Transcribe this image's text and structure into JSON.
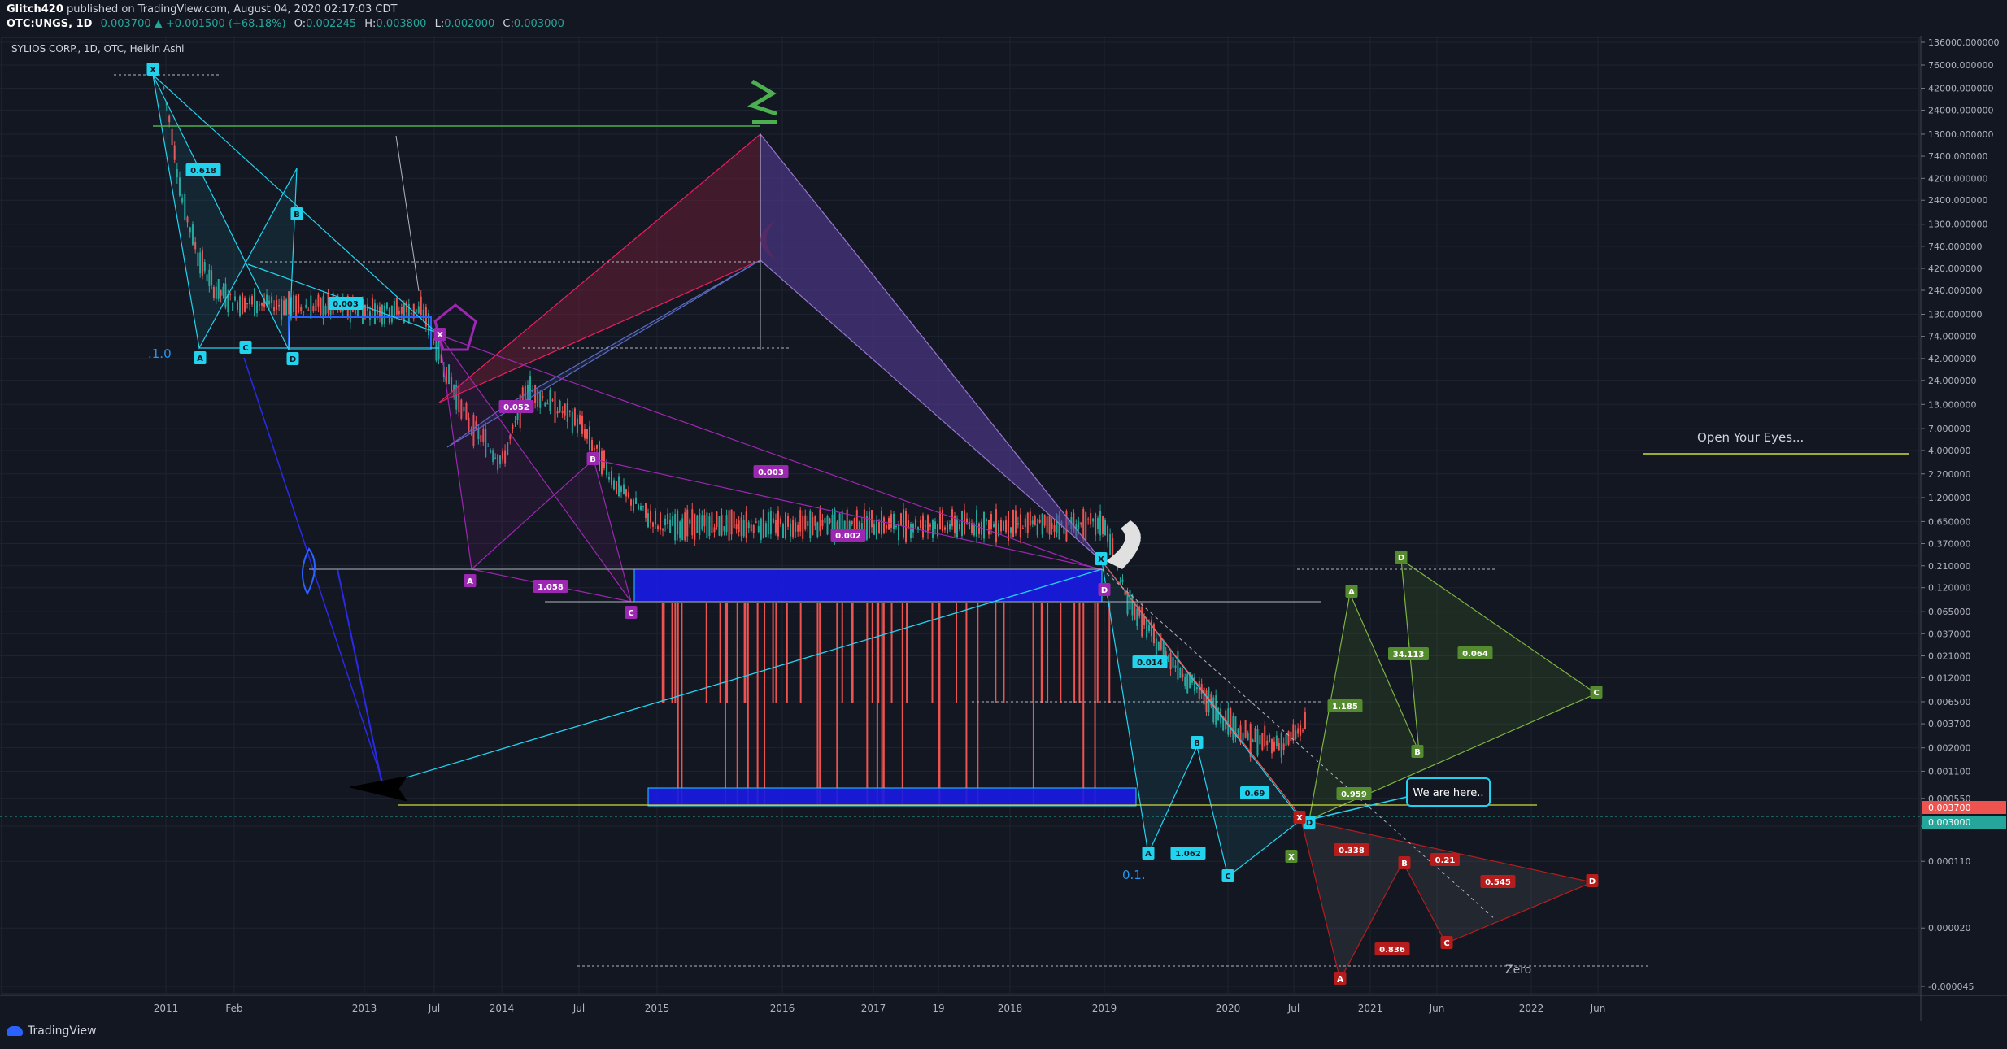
{
  "header": {
    "publisher": "Glitch420",
    "publish_note": "published on TradingView.com, August 04, 2020 02:17:03 CDT",
    "symbol": "OTC:UNGS, 1D",
    "last": "0.003700",
    "change": "+0.001500 (+68.18%)",
    "o_label": "O:",
    "o": "0.002245",
    "h_label": "H:",
    "h": "0.003800",
    "l_label": "L:",
    "l": "0.002000",
    "c_label": "C:",
    "c": "0.003000"
  },
  "legend_title": "SYLIOS CORP., 1D, OTC, Heikin Ashi",
  "brand": "TradingView",
  "colors": {
    "bg": "#131722",
    "grid": "#1e2330",
    "cyan": "#22d3ee",
    "purple": "#9c27b0",
    "blue": "#1a1ae6",
    "green": "#4caf50",
    "red": "#b71c1c",
    "yellow": "#cddc39",
    "candle_up": "#26a69a",
    "candle_down": "#ef5350"
  },
  "chart_data": {
    "type": "candlestick",
    "scale": "log",
    "y_ticks": [
      "136000.000000",
      "76000.000000",
      "42000.000000",
      "24000.000000",
      "13000.000000",
      "7400.000000",
      "4200.000000",
      "2400.000000",
      "1300.000000",
      "740.000000",
      "420.000000",
      "240.000000",
      "130.000000",
      "74.000000",
      "42.000000",
      "24.000000",
      "13.000000",
      "7.000000",
      "4.000000",
      "2.200000",
      "1.200000",
      "0.650000",
      "0.370000",
      "0.210000",
      "0.120000",
      "0.065000",
      "0.037000",
      "0.021000",
      "0.012000",
      "0.006500",
      "0.003700",
      "0.002000",
      "0.001100",
      "0.000550",
      "0.000270",
      "0.000110",
      "0.000020",
      "-0.000045"
    ],
    "y_tick_values": [
      136000,
      76000,
      42000,
      24000,
      13000,
      7400,
      4200,
      2400,
      1300,
      740,
      420,
      240,
      130,
      74,
      42,
      24,
      13,
      7,
      4,
      2.2,
      1.2,
      0.65,
      0.37,
      0.21,
      0.12,
      0.065,
      0.037,
      0.021,
      0.012,
      0.0065,
      0.0037,
      0.002,
      0.0011,
      0.00055,
      0.00027,
      0.00011,
      2e-05,
      4.5e-06
    ],
    "x_ticks": [
      "2011",
      "Feb",
      "2013",
      "Jul",
      "2014",
      "Jul",
      "2015",
      "2016",
      "2017",
      "19",
      "2018",
      "2019",
      "2020",
      "Jul",
      "2021",
      "Jun",
      "2022",
      "Jun"
    ],
    "x_tick_dates": [
      "2011-01-01",
      "2012-02-01",
      "2013-01-01",
      "2013-07-01",
      "2014-01-01",
      "2014-07-01",
      "2015-01-01",
      "2016-01-01",
      "2017-01-01",
      "2017-07-01",
      "2018-01-01",
      "2019-01-01",
      "2020-01-01",
      "2020-07-01",
      "2021-01-01",
      "2021-06-01",
      "2022-01-01",
      "2022-06-01"
    ],
    "price_labels": [
      {
        "text": "0.003700",
        "color": "#ef5350"
      },
      {
        "text": "0.003000",
        "color": "#26a69a"
      }
    ],
    "price_label_values": [
      0.0037,
      0.003
    ],
    "approx_closes": [
      [
        "2010-12-15",
        42000
      ],
      [
        "2011-02-01",
        13000
      ],
      [
        "2011-04-01",
        2400
      ],
      [
        "2011-07-01",
        600
      ],
      [
        "2011-10-01",
        250
      ],
      [
        "2012-02-01",
        180
      ],
      [
        "2012-07-01",
        160
      ],
      [
        "2013-01-01",
        150
      ],
      [
        "2013-06-01",
        140
      ],
      [
        "2013-08-01",
        30
      ],
      [
        "2013-10-01",
        8
      ],
      [
        "2014-01-01",
        3
      ],
      [
        "2014-03-01",
        20
      ],
      [
        "2014-07-01",
        8
      ],
      [
        "2014-10-01",
        1.5
      ],
      [
        "2015-01-01",
        0.6
      ],
      [
        "2016-01-01",
        0.6
      ],
      [
        "2017-01-01",
        0.6
      ],
      [
        "2018-01-01",
        0.6
      ],
      [
        "2019-01-01",
        0.6
      ],
      [
        "2019-03-01",
        0.1
      ],
      [
        "2019-06-01",
        0.03
      ],
      [
        "2019-09-01",
        0.012
      ],
      [
        "2019-12-01",
        0.005
      ],
      [
        "2020-03-01",
        0.0025
      ],
      [
        "2020-06-01",
        0.0022
      ],
      [
        "2020-08-01",
        0.0037
      ]
    ],
    "patterns": [
      {
        "color": "#22d3ee",
        "labels": [
          "X",
          "A",
          "B",
          "C",
          "D"
        ],
        "ratios": [
          "0.618",
          "0.003"
        ]
      },
      {
        "color": "#9c27b0",
        "labels": [
          "X",
          "A",
          "B",
          "C",
          "D"
        ],
        "ratios": [
          "0.052",
          "1.058",
          "0.003",
          "0.002"
        ]
      },
      {
        "color": "#22d3ee",
        "labels": [
          "X",
          "A",
          "B",
          "C",
          "D"
        ],
        "ratios": [
          "0.014",
          "1.062",
          "0.69"
        ]
      },
      {
        "color": "#558b2f",
        "labels": [
          "X",
          "A",
          "B",
          "C",
          "D"
        ],
        "ratios": [
          "1.185",
          "0.959",
          "34.113",
          "0.064"
        ]
      },
      {
        "color": "#b71c1c",
        "labels": [
          "X",
          "A",
          "B",
          "C",
          "D"
        ],
        "ratios": [
          "0.338",
          "0.21",
          "0.836",
          "0.545"
        ]
      }
    ],
    "annotations": {
      "level_1": ".1.0",
      "level_01": "0.1.",
      "zero": "Zero",
      "open_eyes": "Open Your Eyes...",
      "we_are_here": "We are here.."
    }
  }
}
